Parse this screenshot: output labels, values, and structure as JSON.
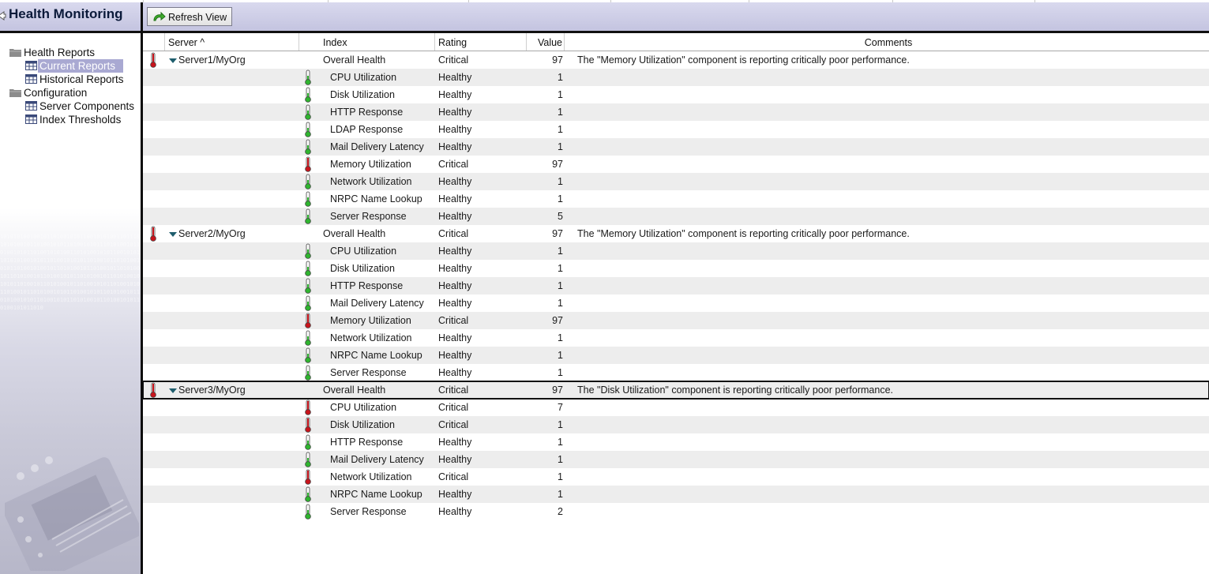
{
  "sidebar": {
    "title": "Health Monitoring",
    "tree": [
      {
        "label": "Health Reports",
        "icon": "folder-icon",
        "level": 0,
        "selected": false
      },
      {
        "label": "Current Reports",
        "icon": "table-icon",
        "level": 1,
        "selected": true
      },
      {
        "label": "Historical Reports",
        "icon": "table-icon",
        "level": 1,
        "selected": false
      },
      {
        "label": "Configuration",
        "icon": "folder-icon",
        "level": 0,
        "selected": false
      },
      {
        "label": "Server Components",
        "icon": "table-icon",
        "level": 1,
        "selected": false
      },
      {
        "label": "Index Thresholds",
        "icon": "table-icon",
        "level": 1,
        "selected": false
      }
    ],
    "binary_text": "1010101001001011010010101100101010011011101010100101101001010110100101011101010010110100101011010010101001101010010101100101011010101001010110100101010110100101101010010101101001010010110101001011010010110101001011010100101101001010110101001011010100101010110100101101010010110100101011010010101101001011010100101011010010101101010010110101001010110100101011010100101101001010110100101011010"
  },
  "toolbar": {
    "refresh_label": "Refresh View"
  },
  "columns": {
    "server": "Server ^",
    "index": "Index",
    "rating": "Rating",
    "value": "Value",
    "comments": "Comments"
  },
  "colors": {
    "critical": "#c8141c",
    "healthy": "#2fb52f",
    "header_bg": "#c8c8e2",
    "selected_bg": "#a9a9d2"
  },
  "groups": [
    {
      "server": "Server1/MyOrg",
      "index": "Overall Health",
      "rating": "Critical",
      "value": "97",
      "comment": "The \"Memory Utilization\" component is reporting critically poor performance.",
      "focused": false,
      "items": [
        {
          "index": "CPU Utilization",
          "rating": "Healthy",
          "value": "1"
        },
        {
          "index": "Disk Utilization",
          "rating": "Healthy",
          "value": "1"
        },
        {
          "index": "HTTP Response",
          "rating": "Healthy",
          "value": "1"
        },
        {
          "index": "LDAP Response",
          "rating": "Healthy",
          "value": "1"
        },
        {
          "index": "Mail Delivery Latency",
          "rating": "Healthy",
          "value": "1"
        },
        {
          "index": "Memory Utilization",
          "rating": "Critical",
          "value": "97"
        },
        {
          "index": "Network Utilization",
          "rating": "Healthy",
          "value": "1"
        },
        {
          "index": "NRPC Name Lookup",
          "rating": "Healthy",
          "value": "1"
        },
        {
          "index": "Server Response",
          "rating": "Healthy",
          "value": "5"
        }
      ]
    },
    {
      "server": "Server2/MyOrg",
      "index": "Overall Health",
      "rating": "Critical",
      "value": "97",
      "comment": "The \"Memory Utilization\" component is reporting critically poor performance.",
      "focused": false,
      "items": [
        {
          "index": "CPU Utilization",
          "rating": "Healthy",
          "value": "1"
        },
        {
          "index": "Disk Utilization",
          "rating": "Healthy",
          "value": "1"
        },
        {
          "index": "HTTP Response",
          "rating": "Healthy",
          "value": "1"
        },
        {
          "index": "Mail Delivery Latency",
          "rating": "Healthy",
          "value": "1"
        },
        {
          "index": "Memory Utilization",
          "rating": "Critical",
          "value": "97"
        },
        {
          "index": "Network Utilization",
          "rating": "Healthy",
          "value": "1"
        },
        {
          "index": "NRPC Name Lookup",
          "rating": "Healthy",
          "value": "1"
        },
        {
          "index": "Server Response",
          "rating": "Healthy",
          "value": "1"
        }
      ]
    },
    {
      "server": "Server3/MyOrg",
      "index": "Overall Health",
      "rating": "Critical",
      "value": "97",
      "comment": "The \"Disk Utilization\" component is reporting critically poor performance.",
      "focused": true,
      "items": [
        {
          "index": "CPU Utilization",
          "rating": "Critical",
          "value": "7"
        },
        {
          "index": "Disk Utilization",
          "rating": "Critical",
          "value": "1"
        },
        {
          "index": "HTTP Response",
          "rating": "Healthy",
          "value": "1"
        },
        {
          "index": "Mail Delivery Latency",
          "rating": "Healthy",
          "value": "1"
        },
        {
          "index": "Network Utilization",
          "rating": "Critical",
          "value": "1"
        },
        {
          "index": "NRPC Name Lookup",
          "rating": "Healthy",
          "value": "1"
        },
        {
          "index": "Server Response",
          "rating": "Healthy",
          "value": "2"
        }
      ]
    }
  ]
}
